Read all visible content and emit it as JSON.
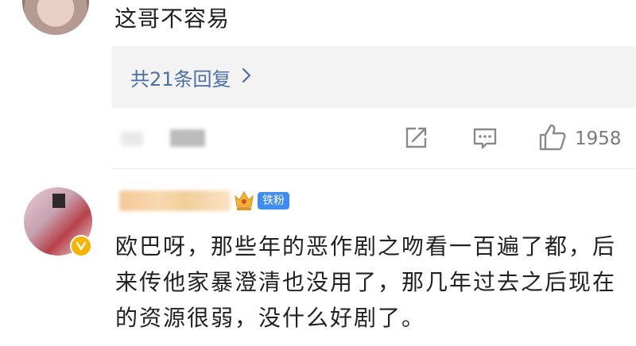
{
  "comment_1": {
    "text": "这哥不容易",
    "reply_link": "共21条回复"
  },
  "actions": {
    "like_count": "1958",
    "icons": [
      "share-icon",
      "comment-icon",
      "thumbs-up-icon"
    ]
  },
  "comment_2": {
    "badge": "铁粉",
    "text": "欧巴呀，那些年的恶作剧之吻看一百遍了都，后来传他家暴澄清也没用了，那几年过去之后现在的资源很弱，没什么好剧了。"
  },
  "colors": {
    "link": "#4a6ea8",
    "badge_bg": "#3d8df5",
    "verified": "#f5b400",
    "reply_bg": "#f3f3f3",
    "icon": "#8a8a8a"
  }
}
